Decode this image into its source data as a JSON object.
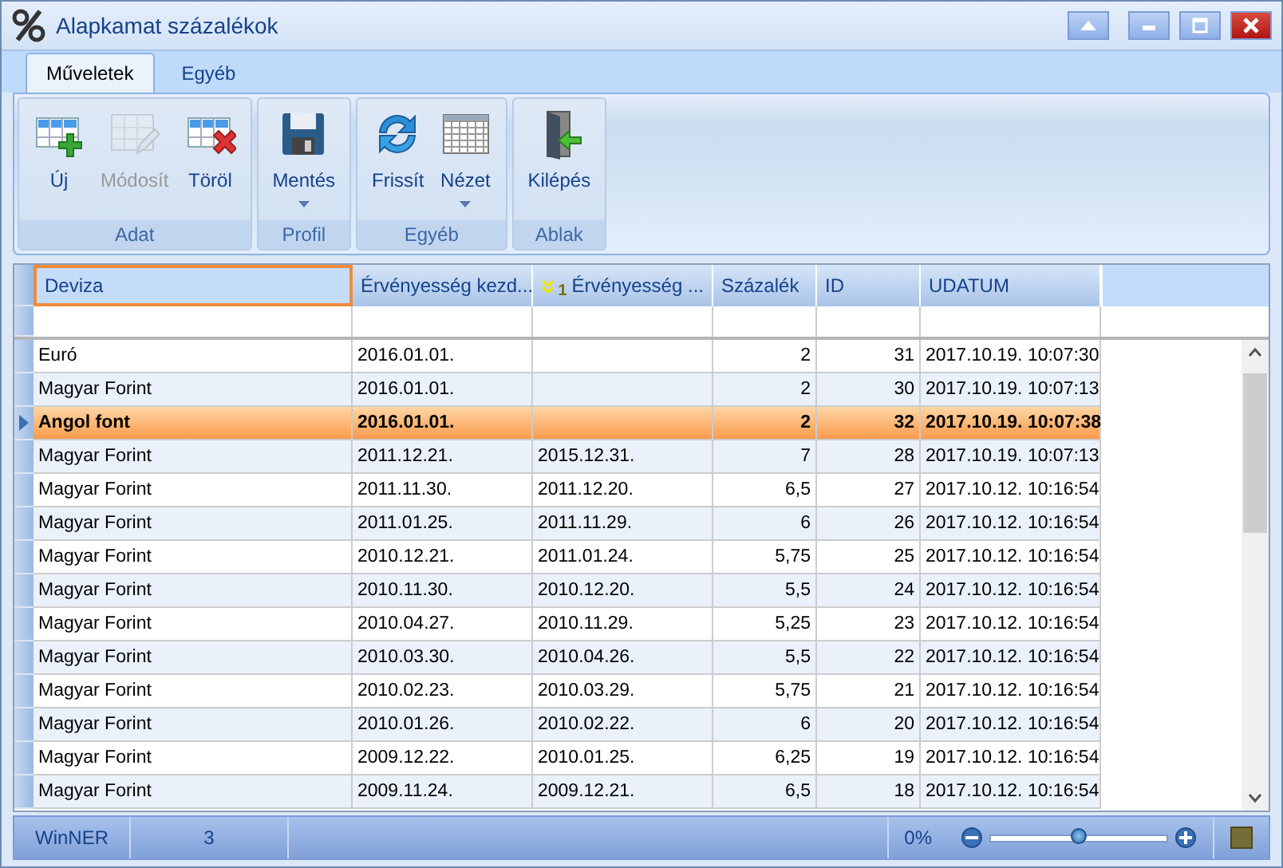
{
  "window": {
    "title": "Alapkamat százalékok"
  },
  "tabs": [
    {
      "label": "Műveletek",
      "selected": true
    },
    {
      "label": "Egyéb",
      "selected": false
    }
  ],
  "ribbon": {
    "groups": [
      {
        "label": "Adat",
        "buttons": [
          {
            "label": "Új",
            "kind": "add",
            "disabled": false,
            "dropdown": false
          },
          {
            "label": "Módosít",
            "kind": "edit",
            "disabled": true,
            "dropdown": false
          },
          {
            "label": "Töröl",
            "kind": "delete",
            "disabled": false,
            "dropdown": false
          }
        ]
      },
      {
        "label": "Profil",
        "buttons": [
          {
            "label": "Mentés",
            "kind": "save",
            "disabled": false,
            "dropdown": true
          }
        ]
      },
      {
        "label": "Egyéb",
        "buttons": [
          {
            "label": "Frissít",
            "kind": "refresh",
            "disabled": false,
            "dropdown": false
          },
          {
            "label": "Nézet",
            "kind": "view",
            "disabled": false,
            "dropdown": true
          }
        ]
      },
      {
        "label": "Ablak",
        "buttons": [
          {
            "label": "Kilépés",
            "kind": "exit",
            "disabled": false,
            "dropdown": false
          }
        ]
      }
    ]
  },
  "grid": {
    "columns": [
      {
        "label": "Deviza",
        "kind": "text",
        "focused": true
      },
      {
        "label": "Érvényesség kezd...",
        "kind": "text",
        "focused": false
      },
      {
        "label": "Érvényesség ...",
        "kind": "text",
        "focused": false,
        "sort": "1"
      },
      {
        "label": "Százalék",
        "kind": "number",
        "focused": false
      },
      {
        "label": "ID",
        "kind": "number",
        "focused": false
      },
      {
        "label": "UDATUM",
        "kind": "text",
        "focused": false
      }
    ],
    "rows": [
      {
        "selected": false,
        "cells": [
          "Euró",
          "2016.01.01.",
          null,
          "2",
          "31",
          "2017.10.19. 10:07:30"
        ]
      },
      {
        "selected": false,
        "cells": [
          "Magyar Forint",
          "2016.01.01.",
          null,
          "2",
          "30",
          "2017.10.19. 10:07:13"
        ]
      },
      {
        "selected": true,
        "cells": [
          "Angol font",
          "2016.01.01.",
          null,
          "2",
          "32",
          "2017.10.19. 10:07:38"
        ]
      },
      {
        "selected": false,
        "cells": [
          "Magyar Forint",
          "2011.12.21.",
          "2015.12.31.",
          "7",
          "28",
          "2017.10.19. 10:07:13"
        ]
      },
      {
        "selected": false,
        "cells": [
          "Magyar Forint",
          "2011.11.30.",
          "2011.12.20.",
          "6,5",
          "27",
          "2017.10.12. 10:16:54"
        ]
      },
      {
        "selected": false,
        "cells": [
          "Magyar Forint",
          "2011.01.25.",
          "2011.11.29.",
          "6",
          "26",
          "2017.10.12. 10:16:54"
        ]
      },
      {
        "selected": false,
        "cells": [
          "Magyar Forint",
          "2010.12.21.",
          "2011.01.24.",
          "5,75",
          "25",
          "2017.10.12. 10:16:54"
        ]
      },
      {
        "selected": false,
        "cells": [
          "Magyar Forint",
          "2010.11.30.",
          "2010.12.20.",
          "5,5",
          "24",
          "2017.10.12. 10:16:54"
        ]
      },
      {
        "selected": false,
        "cells": [
          "Magyar Forint",
          "2010.04.27.",
          "2010.11.29.",
          "5,25",
          "23",
          "2017.10.12. 10:16:54"
        ]
      },
      {
        "selected": false,
        "cells": [
          "Magyar Forint",
          "2010.03.30.",
          "2010.04.26.",
          "5,5",
          "22",
          "2017.10.12. 10:16:54"
        ]
      },
      {
        "selected": false,
        "cells": [
          "Magyar Forint",
          "2010.02.23.",
          "2010.03.29.",
          "5,75",
          "21",
          "2017.10.12. 10:16:54"
        ]
      },
      {
        "selected": false,
        "cells": [
          "Magyar Forint",
          "2010.01.26.",
          "2010.02.22.",
          "6",
          "20",
          "2017.10.12. 10:16:54"
        ]
      },
      {
        "selected": false,
        "cells": [
          "Magyar Forint",
          "2009.12.22.",
          "2010.01.25.",
          "6,25",
          "19",
          "2017.10.12. 10:16:54"
        ]
      },
      {
        "selected": false,
        "cells": [
          "Magyar Forint",
          "2009.11.24.",
          "2009.12.21.",
          "6,5",
          "18",
          "2017.10.12. 10:16:54"
        ]
      }
    ]
  },
  "status_bar": {
    "panels": [
      "WinNER",
      "3"
    ],
    "zoom": {
      "reading": "0%",
      "level": 0.5
    }
  }
}
